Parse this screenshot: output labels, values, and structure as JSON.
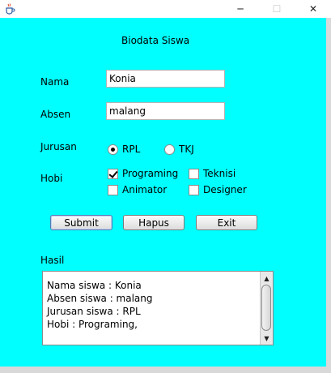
{
  "window": {
    "title_icon": "java-cup-icon",
    "minimize_glyph": "─",
    "maximize_glyph": "☐",
    "close_glyph": "✕"
  },
  "form": {
    "title": "Biodata Siswa",
    "nama_label": "Nama",
    "nama_value": "Konia",
    "absen_label": "Absen",
    "absen_value": "malang",
    "jurusan_label": "Jurusan",
    "jurusan_options": [
      {
        "label": "RPL",
        "selected": true
      },
      {
        "label": "TKJ",
        "selected": false
      }
    ],
    "hobi_label": "Hobi",
    "hobi_options": [
      {
        "label": "Programing",
        "checked": true
      },
      {
        "label": "Teknisi",
        "checked": false
      },
      {
        "label": "Animator",
        "checked": false
      },
      {
        "label": "Designer",
        "checked": false
      }
    ],
    "buttons": {
      "submit": "Submit",
      "hapus": "Hapus",
      "exit": "Exit"
    },
    "hasil_label": "Hasil",
    "hasil_lines": [
      "Nama siswa : Konia",
      "Absen siswa : malang",
      "Jurusan siswa : RPL",
      "Hobi : Programing,"
    ]
  },
  "colors": {
    "panel_background": "#00ffff",
    "window_frame": "#ffffff"
  }
}
